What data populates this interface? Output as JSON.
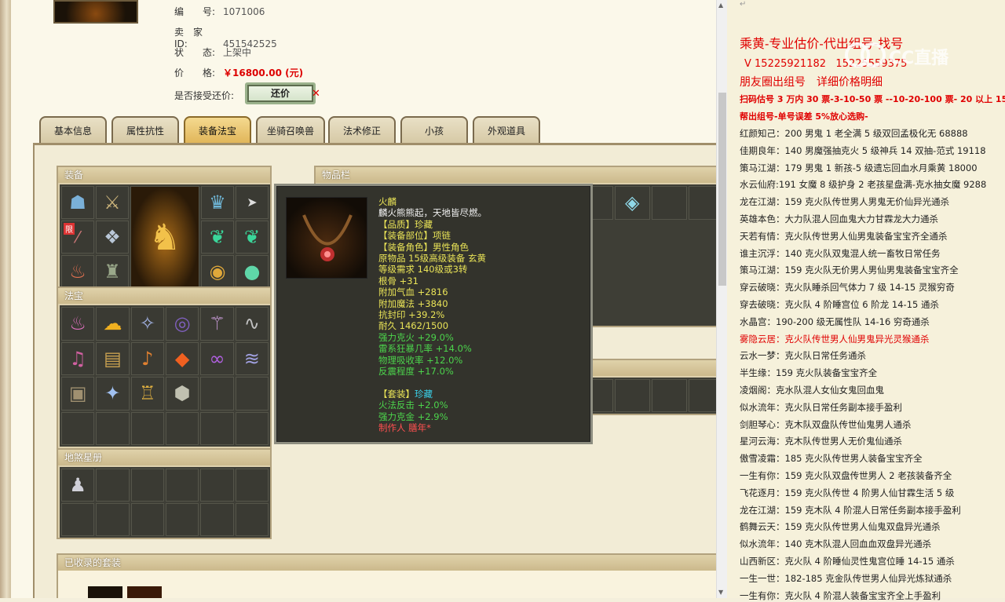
{
  "listing": {
    "id_label": "编　　号:",
    "id_value": "1071006",
    "seller_label": "卖　家　ID:",
    "seller_value": "451542525",
    "status_label": "状　　态:",
    "status_value": "上架中",
    "price_label": "价　　格:",
    "price_value": "￥16800.00 (元)",
    "counter_label": "是否接受还价:",
    "counter_button": "还价"
  },
  "tabs": [
    "基本信息",
    "属性抗性",
    "装备法宝",
    "坐骑召唤兽",
    "法术修正",
    "小孩",
    "外观道具"
  ],
  "active_tab": "装备法宝",
  "sections": {
    "equip": "装备",
    "treasure": "法宝",
    "tianshu": "地煞星册",
    "items": "物品栏",
    "sets": "已收录的套装"
  },
  "equip_icons": [
    "helmet-icon",
    "weapon-icon",
    "portrait",
    "crown-icon",
    "cursor",
    "restricted-icon",
    "necklace-icon",
    "feather-icon",
    "amulet-icon",
    "lantern-icon",
    "boots-icon",
    "ring-icon",
    "pearl-icon"
  ],
  "restricted_badge": "限",
  "tooltip": {
    "name": "火麟",
    "desc": "麟火熊熊起，天地皆尽燃。",
    "quality": "【品质】珍藏",
    "slot": "【装备部位】项链",
    "role": "【装备角色】男性角色",
    "origin": "原物品 15级高级装备 玄黄",
    "level_req": "等级需求 140级或3转",
    "stats_white": [
      "根骨 +31",
      "附加气血 +2816",
      "附加魔法 +3840",
      "抗封印 +39.2%",
      "耐久 1462/1500"
    ],
    "stats_green": [
      "强力克火 +29.0%",
      "雷系狂暴几率 +14.0%",
      "物理吸收率 +12.0%",
      "反震程度 +17.0%"
    ],
    "set_label": "【套装】",
    "set_value": "珍藏",
    "set_stats": [
      "火法反击 +2.0%",
      "强力克金 +2.9%"
    ],
    "maker": "制作人 膳年*"
  },
  "right_panel": {
    "header1": "乘黄-专业估价-代出组号-找号",
    "header2": "V 15225921182",
    "header2b": "15225559375",
    "header3": "朋友圈出组号　详细价格明细",
    "promo1": "扫码估号 3 万内 30 票-3-10-50 票 --10-20-100 票- 20 以上 150",
    "promo2": "帮出组号-单号误差 5%放心选购-",
    "lines": [
      {
        "text": "红颜知己：200 男鬼 1 老全满 5 级双回孟极化无 68888",
        "red": false
      },
      {
        "text": "佳期良年：140 男魔强抽克火 5 级神兵 14 双抽-范式 19118",
        "red": false
      },
      {
        "text": "策马江湖：179 男鬼 1 新孩-5 级遗忘回血水月乘黄 18000",
        "red": false
      },
      {
        "text": "水云仙府:191 女魔 8 级护身 2 老孩星盘满-克水抽女魔 9288",
        "red": false
      },
      {
        "text": "龙在江湖：159 克火队传世男人男鬼无价仙异光通杀",
        "red": false
      },
      {
        "text": "英雄本色：大力队混人回血鬼大力甘霖龙大力通杀",
        "red": false
      },
      {
        "text": "天若有情：克火队传世男人仙男鬼装备宝宝齐全通杀",
        "red": false
      },
      {
        "text": "谁主沉浮：140 克火队双鬼混人统一畜牧日常任务",
        "red": false
      },
      {
        "text": "策马江湖：159 克火队无价男人男仙男鬼装备宝宝齐全",
        "red": false
      },
      {
        "text": "穿云破晓：克火队睡杀回气体力 7 级 14-15 灵猴穷奇",
        "red": false
      },
      {
        "text": "穿去破晓：克火队 4 阶睡宫位 6 阶龙 14-15 通杀",
        "red": false
      },
      {
        "text": "水晶宫：190-200 级无属性队 14-16 穷奇通杀",
        "red": false
      },
      {
        "text": "雾隐云居：克火队传世男人仙男鬼异光灵猴通杀",
        "red": true
      },
      {
        "text": "云水一梦：克火队日常任务通杀",
        "red": false
      },
      {
        "text": "半生缘：159 克火队装备宝宝齐全",
        "red": false
      },
      {
        "text": "凌烟阁：克水队混人女仙女鬼回血鬼",
        "red": false
      },
      {
        "text": "似水流年：克火队日常任务副本接手盈利",
        "red": false
      },
      {
        "text": "剑胆琴心：克木队双盘队传世仙鬼男人通杀",
        "red": false
      },
      {
        "text": "星河云海：克木队传世男人无价鬼仙通杀",
        "red": false
      },
      {
        "text": "傲雪凌霜：185 克火队传世男人装备宝宝齐全",
        "red": false
      },
      {
        "text": "一生有你：159 克火队双盘传世男人 2 老孩装备齐全",
        "red": false
      },
      {
        "text": "飞花逐月：159 克火队传世 4 阶男人仙甘霖生活 5 级",
        "red": false
      },
      {
        "text": "龙在江湖：159 克木队 4 阶混人日常任务副本接手盈利",
        "red": false
      },
      {
        "text": "鹤舞云天：159 克火队传世男人仙鬼双盘异光通杀",
        "red": false
      },
      {
        "text": "似水流年：140 克木队混人回血血双盘异光通杀",
        "red": false
      },
      {
        "text": "山西新区：克火队 4 阶睡仙灵性鬼宫位睡 14-15 通杀",
        "red": false
      },
      {
        "text": "一生一世：182-185 克金队传世男人仙异光炼狱通杀",
        "red": false
      },
      {
        "text": "一生有你：克火队 4 阶混人装备宝宝齐全上手盈利",
        "red": false
      }
    ],
    "top_mark": "↵"
  },
  "watermark_text": "CC直播",
  "colors": {
    "accent": "#e00000",
    "tab_active": "#e1b65a",
    "tooltip_bg": "#33332c",
    "green_stat": "#4cd44c"
  }
}
